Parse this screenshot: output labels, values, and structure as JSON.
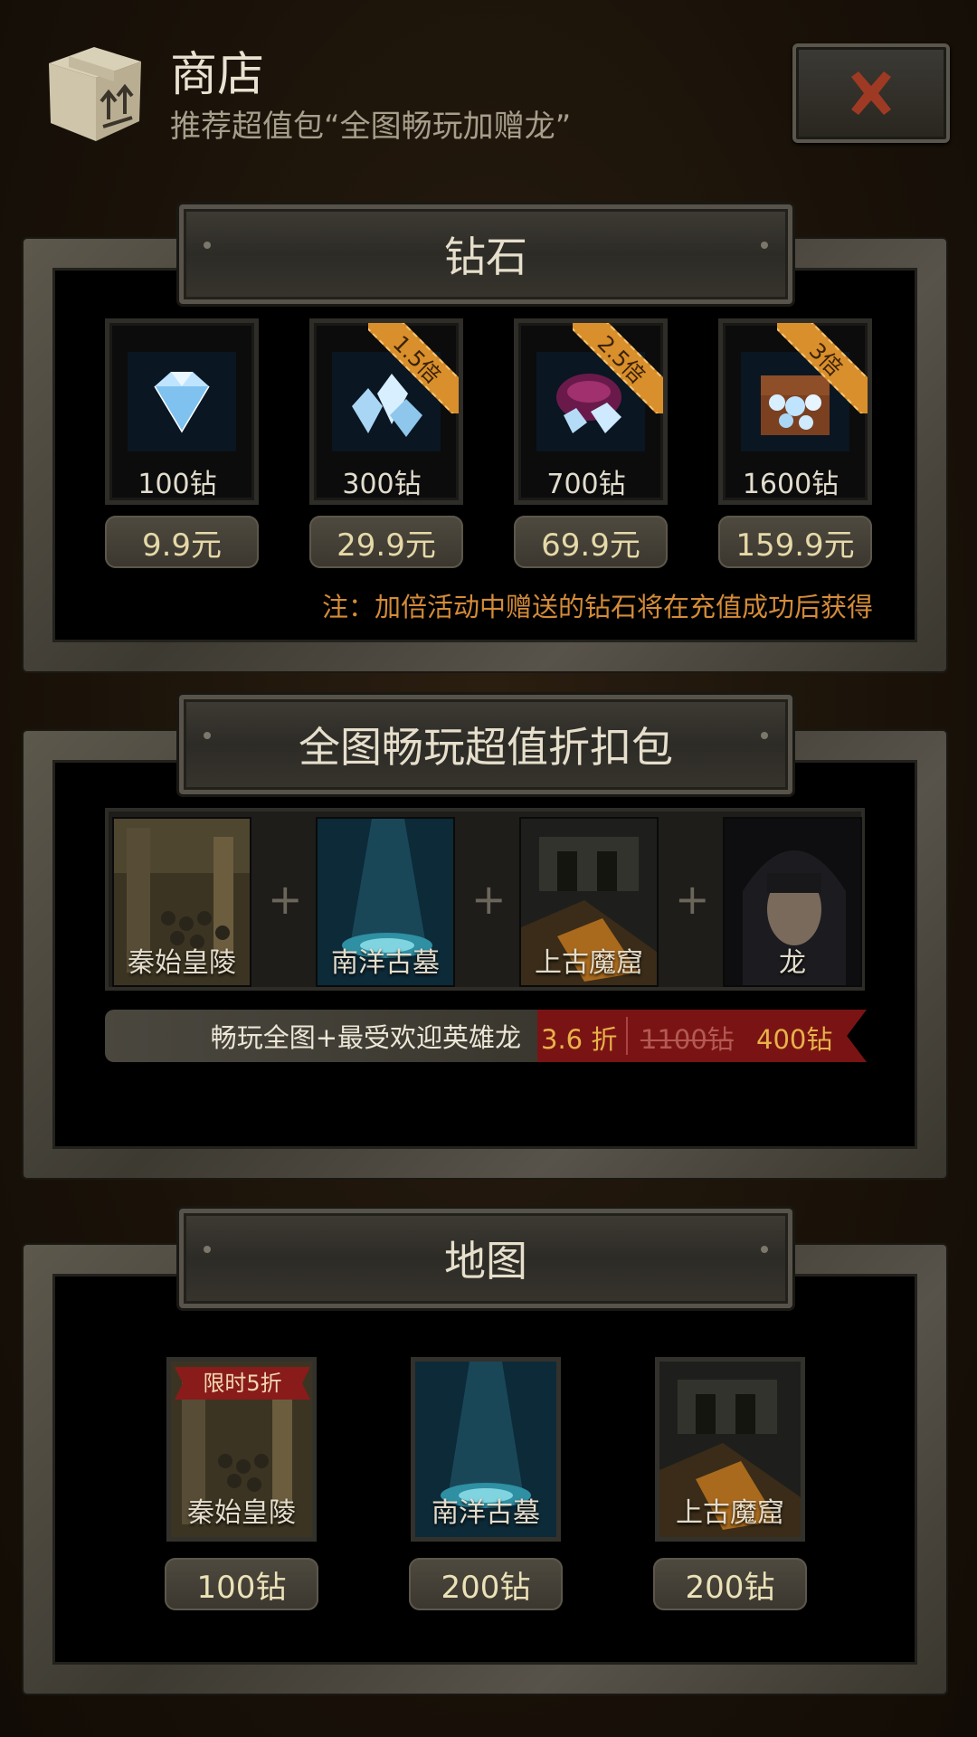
{
  "header": {
    "title": "商店",
    "subtitle": "推荐超值包“全图畅玩加赠龙”"
  },
  "diamonds": {
    "section_title": "钻石",
    "items": [
      {
        "label": "100钻",
        "price": "9.9元",
        "badge": ""
      },
      {
        "label": "300钻",
        "price": "29.9元",
        "badge": "1.5倍"
      },
      {
        "label": "700钻",
        "price": "69.9元",
        "badge": "2.5倍"
      },
      {
        "label": "1600钻",
        "price": "159.9元",
        "badge": "3倍"
      }
    ],
    "note": "注：加倍活动中赠送的钻石将在充值成功后获得"
  },
  "bundle": {
    "section_title": "全图畅玩超值折扣包",
    "tiles": [
      "秦始皇陵",
      "南洋古墓",
      "上古魔窟",
      "龙"
    ],
    "plus_symbol": "+",
    "description": "畅玩全图+最受欢迎英雄龙",
    "discount": "3.6 折",
    "original_price": "1100钻",
    "sale_price": "400钻"
  },
  "maps": {
    "section_title": "地图",
    "items": [
      {
        "name": "秦始皇陵",
        "price": "100钻",
        "tag": "限时5折"
      },
      {
        "name": "南洋古墓",
        "price": "200钻",
        "tag": ""
      },
      {
        "name": "上古魔窟",
        "price": "200钻",
        "tag": ""
      }
    ]
  },
  "colors": {
    "background": "#1a1209",
    "accent_orange": "#d48b38",
    "sale_red": "#7a1414",
    "gold_text": "#e8b24a"
  }
}
